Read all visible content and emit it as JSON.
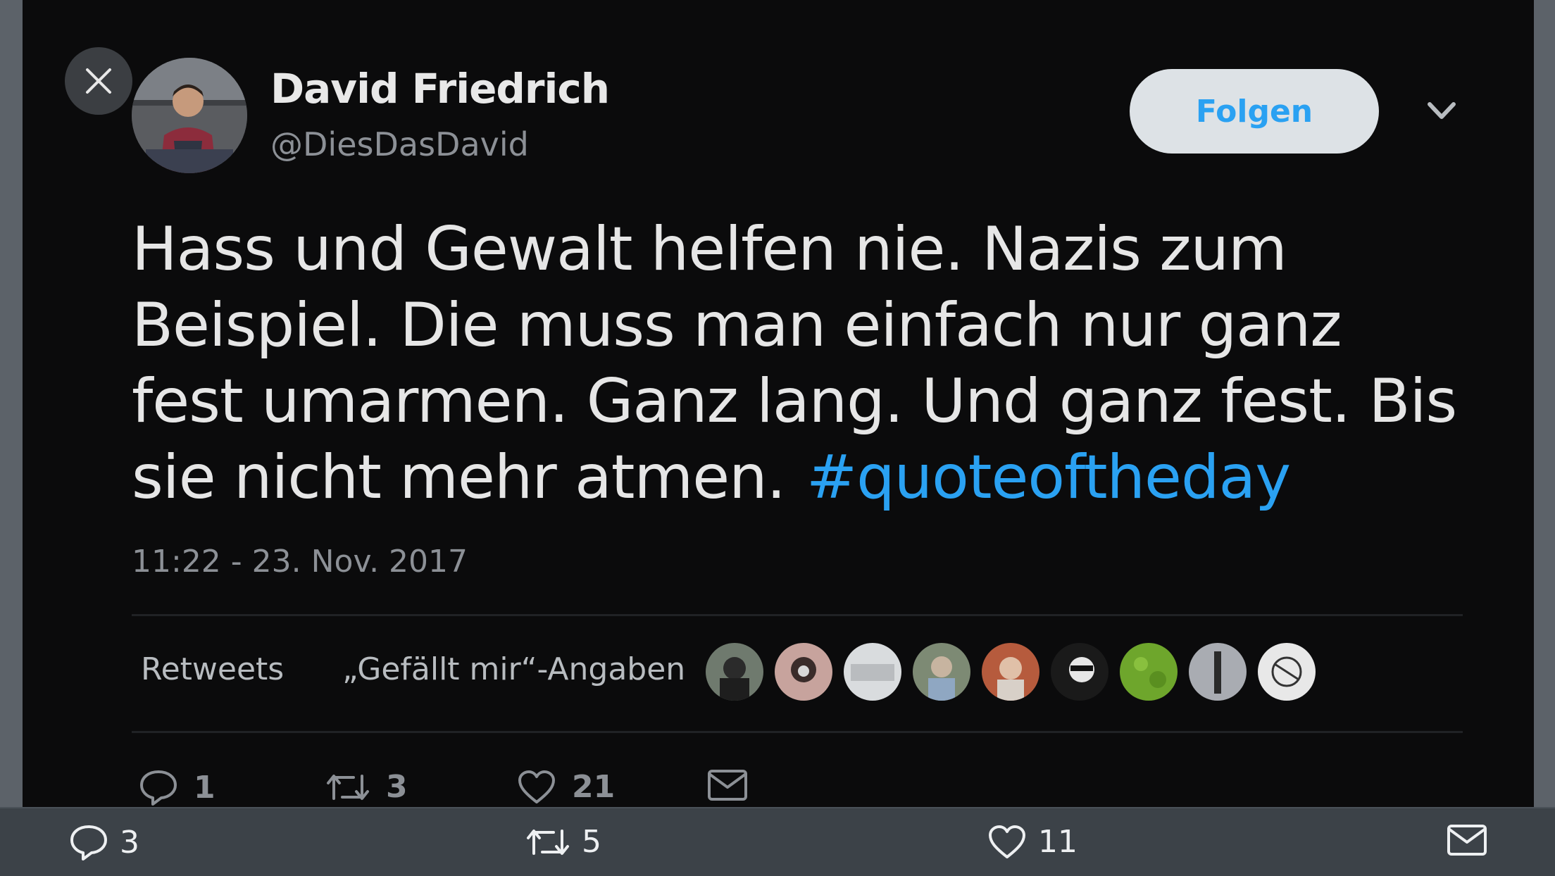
{
  "tweet": {
    "author_name": "David Friedrich",
    "author_handle": "@DiesDasDavid",
    "follow_label": "Folgen",
    "text": "Hass und Gewalt helfen nie. Nazis zum Beispiel. Die muss man einfach nur ganz fest umarmen. Ganz lang. Und ganz fest. Bis sie nicht mehr atmen.",
    "hashtag": "#quoteoftheday",
    "timestamp": "11:22 - 23. Nov. 2017"
  },
  "stats": {
    "retweets_label": "Retweets",
    "likes_label": "„Gefällt mir“-Angaben",
    "liker_avatars": [
      "avatar-1",
      "avatar-2",
      "avatar-3",
      "avatar-4",
      "avatar-5",
      "avatar-6",
      "avatar-7",
      "avatar-8",
      "avatar-9"
    ]
  },
  "actions": {
    "reply_count": "1",
    "retweet_count": "3",
    "like_count": "21"
  },
  "bottom_bar": {
    "reply_count": "3",
    "retweet_count": "5",
    "like_count": "11"
  },
  "icons": {
    "close": "close-icon",
    "chevron": "chevron-down-icon",
    "reply": "reply-icon",
    "retweet": "retweet-icon",
    "like": "heart-icon",
    "message": "envelope-icon"
  },
  "colors": {
    "background": "#0b0b0c",
    "accent": "#2aa1f2",
    "text": "#e6e6e6",
    "muted": "#8c9096",
    "bottom_bar": "#3c4248"
  }
}
